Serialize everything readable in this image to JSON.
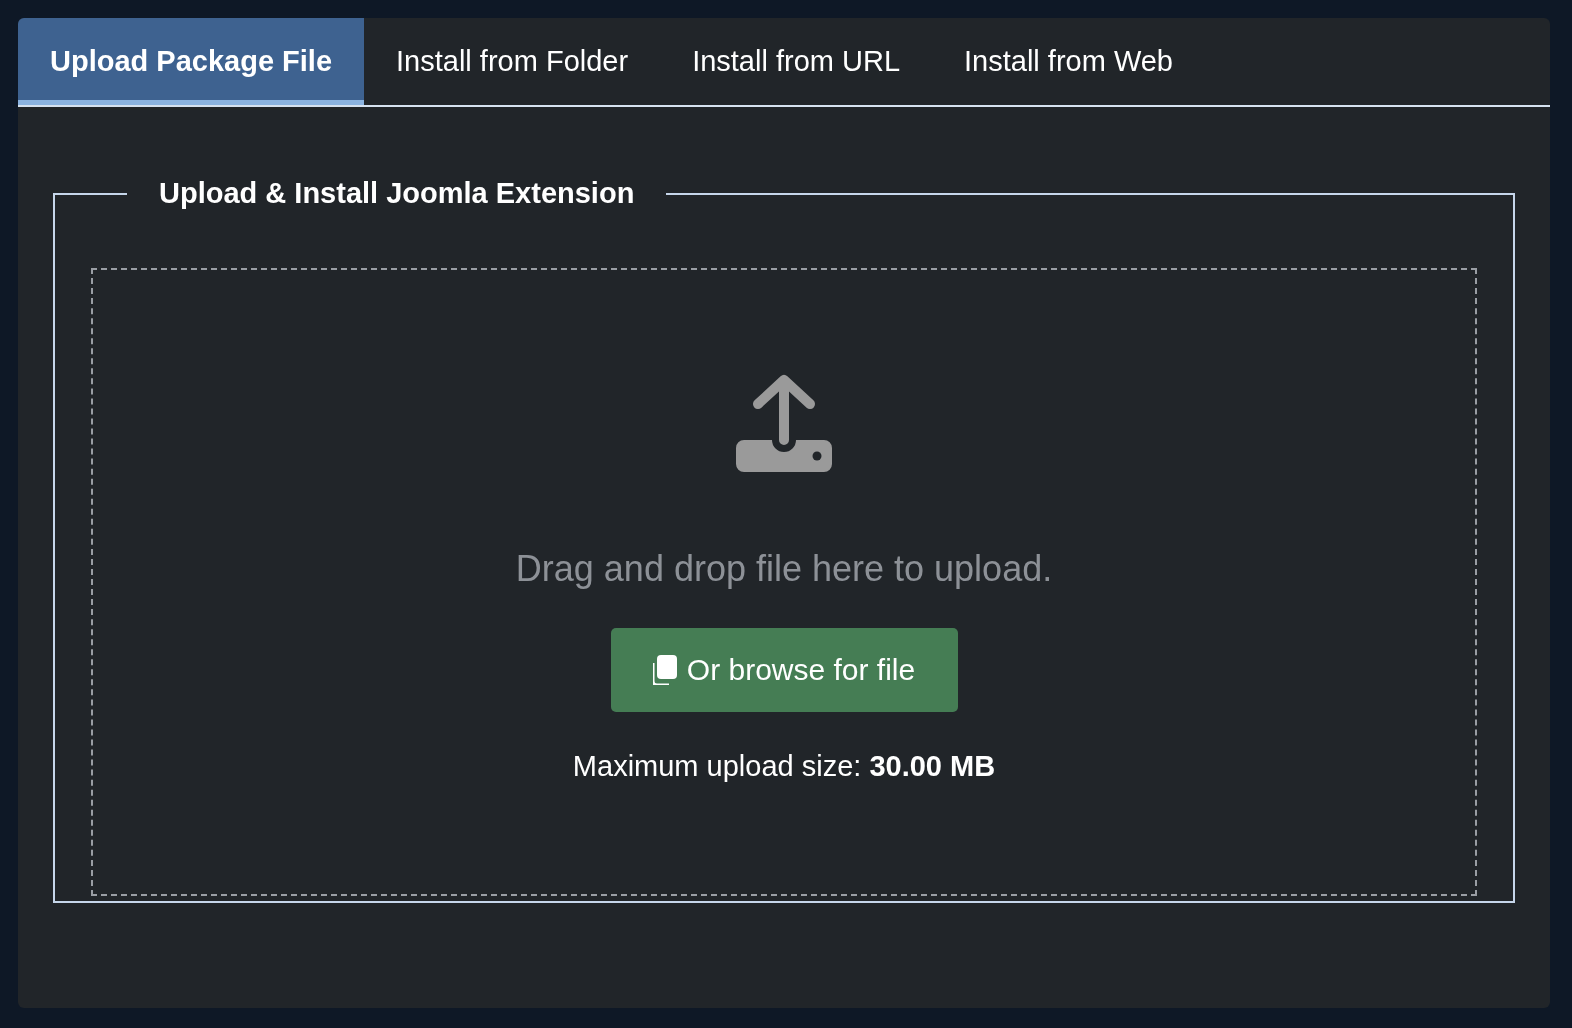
{
  "tabs": [
    {
      "label": "Upload Package File",
      "selected": true
    },
    {
      "label": "Install from Folder",
      "selected": false
    },
    {
      "label": "Install from URL",
      "selected": false
    },
    {
      "label": "Install from Web",
      "selected": false
    }
  ],
  "panel": {
    "legend": "Upload & Install Joomla Extension",
    "drop_hint": "Drag and drop file here to upload.",
    "browse_button": "Or browse for file",
    "max_size": "Maximum upload size: **30.00 MB**"
  }
}
